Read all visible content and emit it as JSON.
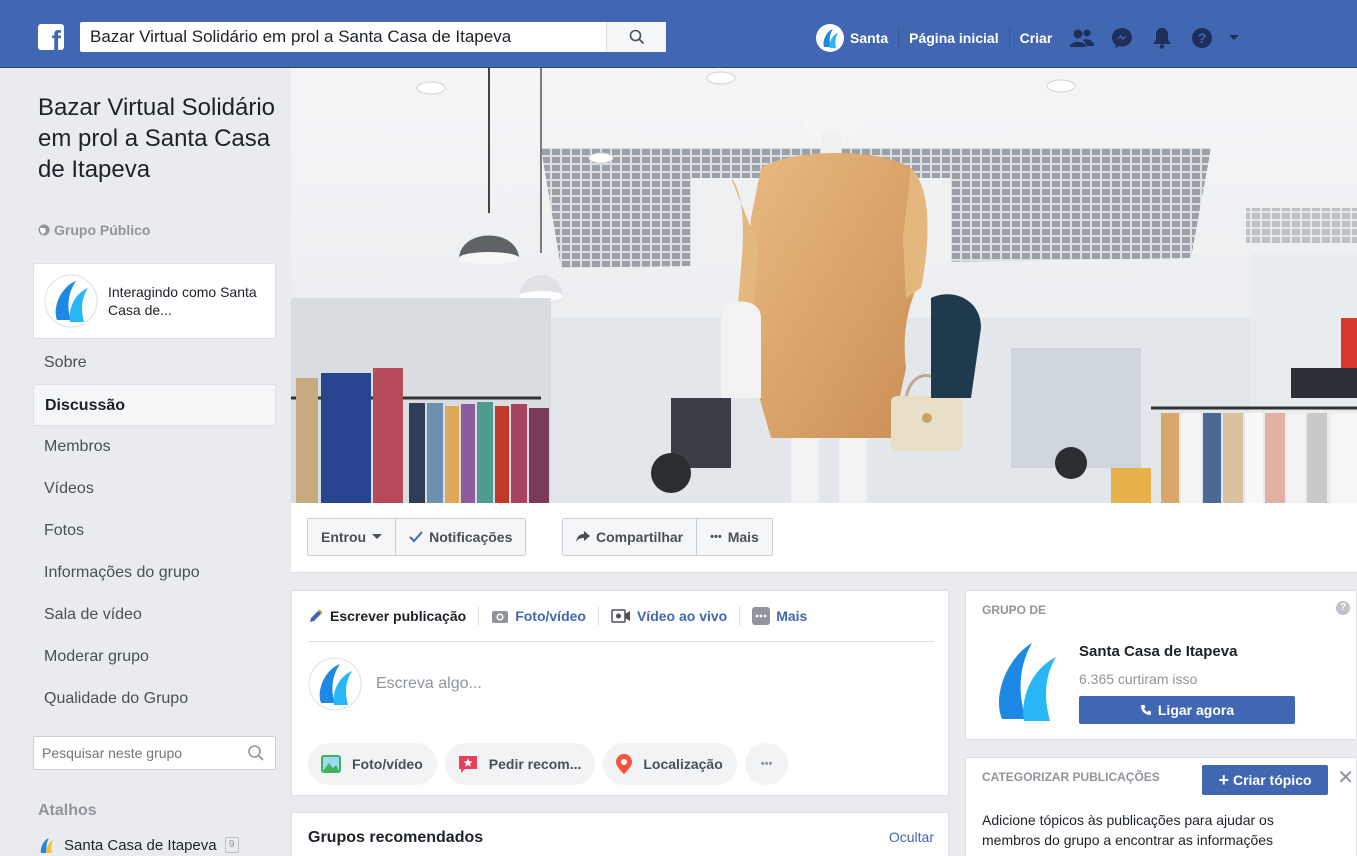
{
  "topbar": {
    "search_value": "Bazar Virtual Solidário em prol a Santa Casa de Itapeva",
    "profile_name": "Santa",
    "home": "Página inicial",
    "create": "Criar"
  },
  "group": {
    "title": "Bazar Virtual Solidário em prol a Santa Casa de Itapeva",
    "type": "Grupo Público",
    "interacting_as": "Interagindo como Santa Casa de..."
  },
  "leftnav": {
    "items": [
      {
        "label": "Sobre"
      },
      {
        "label": "Discussão"
      },
      {
        "label": "Membros"
      },
      {
        "label": "Vídeos"
      },
      {
        "label": "Fotos"
      },
      {
        "label": "Informações do grupo"
      },
      {
        "label": "Sala de vídeo"
      },
      {
        "label": "Moderar grupo"
      },
      {
        "label": "Qualidade do Grupo"
      }
    ],
    "search_placeholder": "Pesquisar neste grupo",
    "shortcuts_title": "Atalhos",
    "shortcut_label": "Santa Casa de Itapeva",
    "shortcut_badge": "9"
  },
  "actions": {
    "joined": "Entrou",
    "notifications": "Notificações",
    "share": "Compartilhar",
    "more": "Mais"
  },
  "composer": {
    "tab_write": "Escrever publicação",
    "tab_photo": "Foto/vídeo",
    "tab_live": "Vídeo ao vivo",
    "tab_more": "Mais",
    "placeholder": "Escreva algo...",
    "chip_photo": "Foto/vídeo",
    "chip_recommend": "Pedir recom...",
    "chip_location": "Localização",
    "chip_more": "•••"
  },
  "recommended": {
    "title": "Grupos recomendados",
    "hide": "Ocultar"
  },
  "owner": {
    "label": "GRUPO DE",
    "page_name": "Santa Casa de Itapeva",
    "likes": "6.365 curtiram isso",
    "call": "Ligar agora"
  },
  "categorize": {
    "label": "CATEGORIZAR PUBLICAÇÕES",
    "create": "Criar tópico",
    "description": "Adicione tópicos às publicações para ajudar os membros do grupo a encontrar as informações"
  },
  "colors": {
    "brand": "#4267b2",
    "background": "#e9ebee",
    "muted_text": "#90949c"
  }
}
